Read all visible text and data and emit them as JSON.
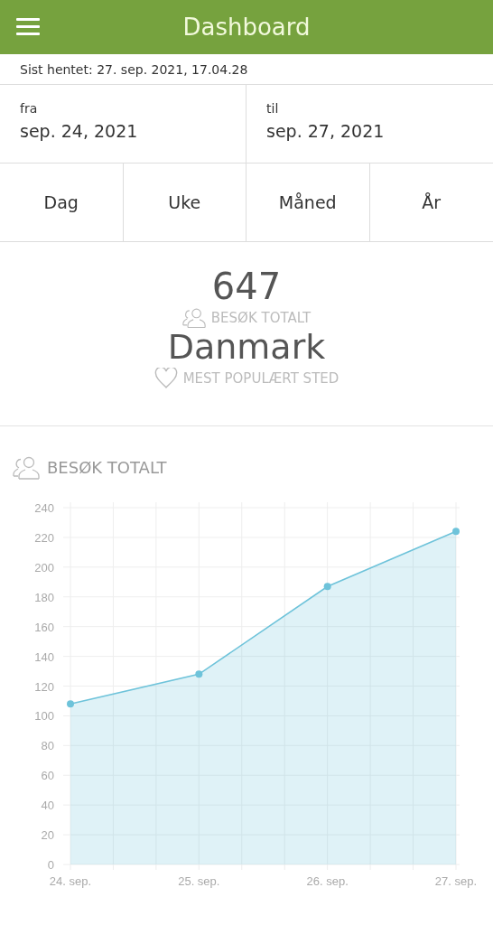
{
  "header": {
    "title": "Dashboard"
  },
  "last_fetched": "Sist hentet: 27. sep. 2021, 17.04.28",
  "date_range": [
    {
      "label": "fra",
      "value": "sep. 24, 2021"
    },
    {
      "label": "til",
      "value": "sep. 27, 2021"
    }
  ],
  "periods": [
    "Dag",
    "Uke",
    "Måned",
    "År"
  ],
  "summary": [
    {
      "kind": "visits",
      "value": "647",
      "caption": "BESØK TOTALT"
    },
    {
      "kind": "place",
      "value": "Danmark",
      "caption": "MEST POPULÆRT STED"
    }
  ],
  "chart_section": {
    "chart_data": {
      "type": "area",
      "title": "BESØK TOTALT",
      "grid": true,
      "categories": [
        "24. sep.",
        "25. sep.",
        "26. sep.",
        "27. sep."
      ],
      "series": [
        {
          "color": "#6ec3da",
          "values": [
            108,
            128,
            187,
            224
          ]
        }
      ],
      "ylim": [
        0,
        240
      ],
      "yticks": [
        0,
        20,
        40,
        60,
        80,
        100,
        120,
        140,
        160,
        180,
        200,
        220,
        240
      ]
    }
  }
}
